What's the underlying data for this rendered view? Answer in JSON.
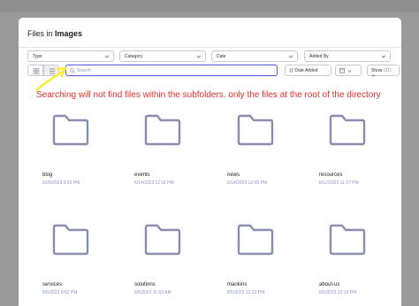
{
  "modal": {
    "title_prefix": "Files in",
    "title_folder": "Images"
  },
  "filters": [
    {
      "label": "Type"
    },
    {
      "label": "Category"
    },
    {
      "label": "Date"
    },
    {
      "label": "Added By"
    }
  ],
  "toolbar": {
    "search_placeholder": "Search",
    "sort_label": "Date Added",
    "show_label": "Show",
    "show_count": "(21)"
  },
  "annotation": {
    "text": "Searching will not find files within the subfolders. only the files at the root of the directory",
    "color": "#e8302c",
    "arrow_color": "#f7ef3a"
  },
  "files": [
    {
      "name": "blog",
      "date": "6/20/2023 3:02 PM",
      "icon": "folder-icon"
    },
    {
      "name": "events",
      "date": "6/14/2023 12:11 PM",
      "icon": "folder-icon"
    },
    {
      "name": "news",
      "date": "6/14/2023 12:05 PM",
      "icon": "folder-icon"
    },
    {
      "name": "resources",
      "date": "6/12/2023 11:17 PM",
      "icon": "folder-icon"
    },
    {
      "name": "services",
      "date": "6/6/2023 8:52 PM",
      "icon": "folder-icon"
    },
    {
      "name": "solutions",
      "date": "6/6/2023 11:53 AM",
      "icon": "folder-icon"
    },
    {
      "name": "mankins",
      "date": "6/5/2023 12:22 PM",
      "icon": "folder-icon"
    },
    {
      "name": "about-us",
      "date": "6/5/2023 12:19 PM",
      "icon": "folder-icon"
    }
  ],
  "colors": {
    "accent": "#5d63d8",
    "folder_stroke": "#8a8cb0",
    "date_text": "#8f92c9"
  }
}
